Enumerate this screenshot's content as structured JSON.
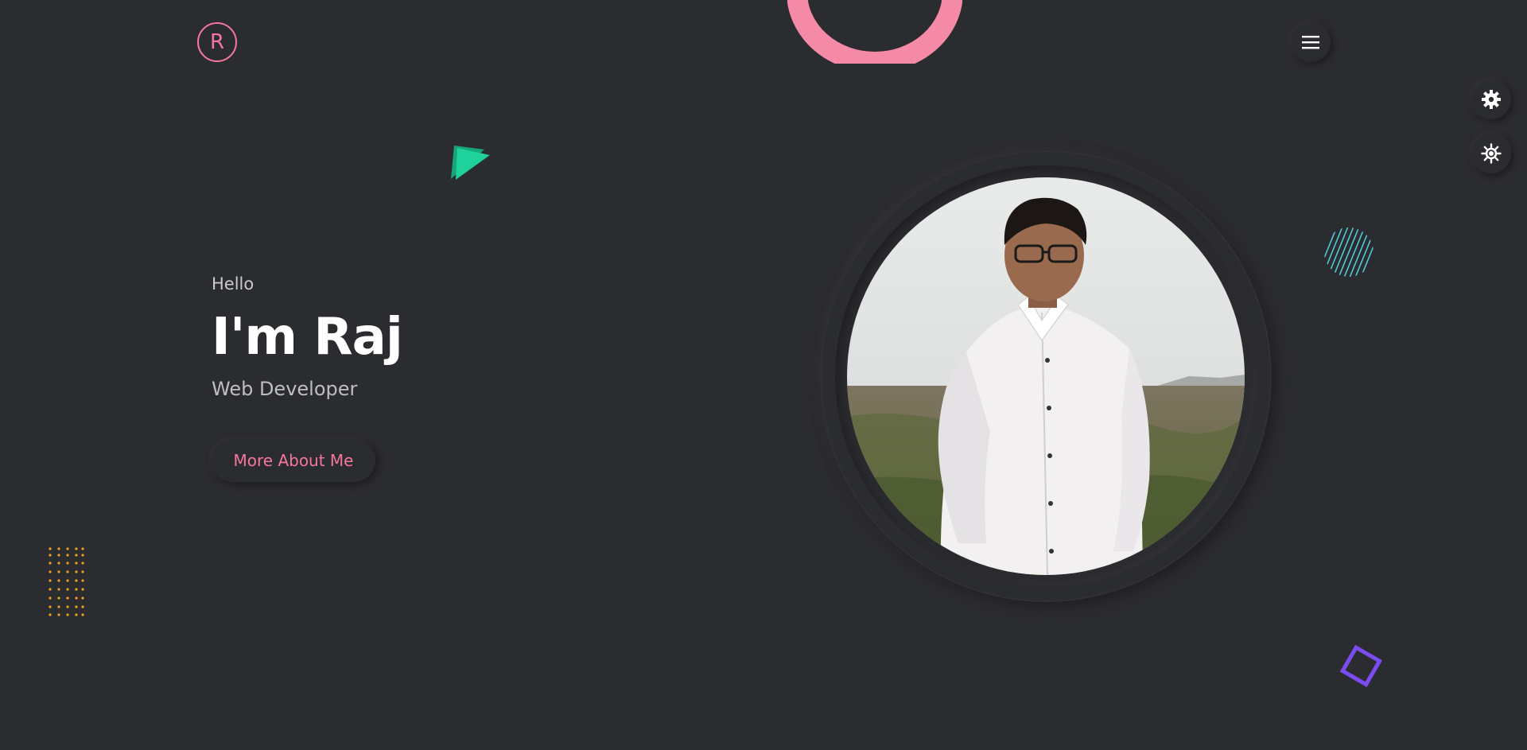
{
  "header": {
    "logo_letter": "R"
  },
  "icons": {
    "menu": "hamburger-menu-icon",
    "settings": "gear-icon",
    "theme": "sun-icon"
  },
  "hero": {
    "greeting": "Hello",
    "name": "I'm Raj",
    "role": "Web Developer",
    "cta_label": "More About Me"
  },
  "colors": {
    "background": "#2b2c30",
    "accent_pink": "#f5779d",
    "triangle_green": "#1fd19a",
    "stripes_cyan": "#52c8d8",
    "dots_orange": "#f0a020",
    "square_purple": "#7b4df0"
  }
}
